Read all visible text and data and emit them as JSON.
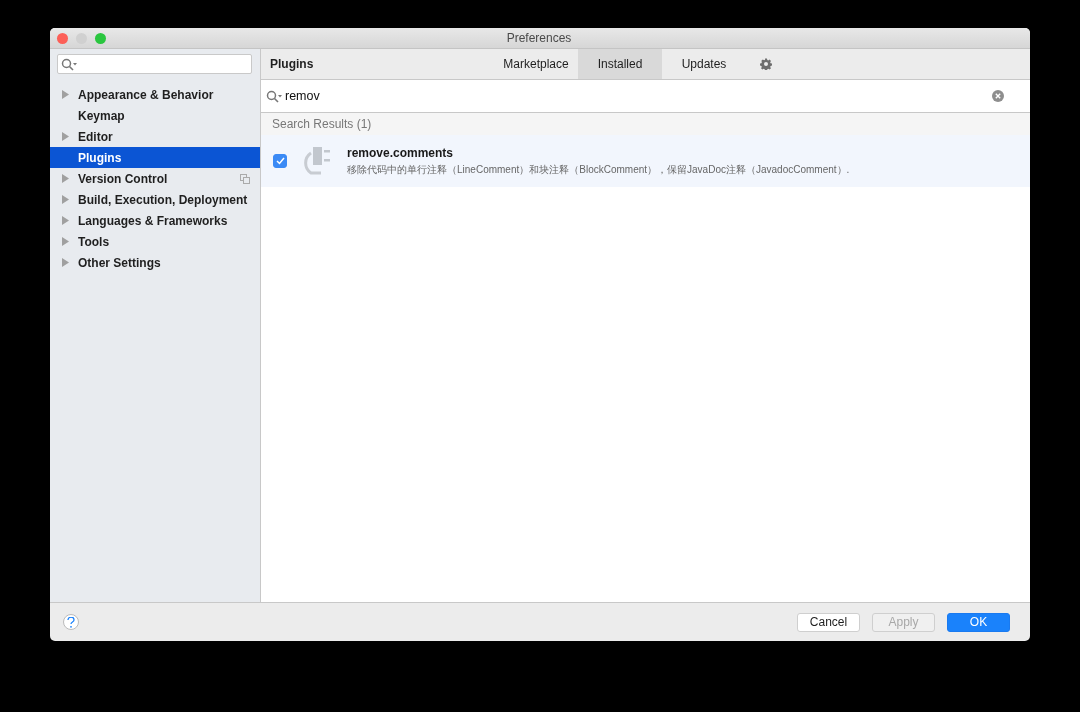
{
  "window": {
    "title": "Preferences"
  },
  "sidebar": {
    "items": [
      {
        "label": "Appearance & Behavior",
        "expandable": true,
        "selected": false,
        "scoped": false
      },
      {
        "label": "Keymap",
        "expandable": false,
        "selected": false,
        "scoped": false
      },
      {
        "label": "Editor",
        "expandable": true,
        "selected": false,
        "scoped": false
      },
      {
        "label": "Plugins",
        "expandable": false,
        "selected": true,
        "scoped": false
      },
      {
        "label": "Version Control",
        "expandable": true,
        "selected": false,
        "scoped": true
      },
      {
        "label": "Build, Execution, Deployment",
        "expandable": true,
        "selected": false,
        "scoped": false
      },
      {
        "label": "Languages & Frameworks",
        "expandable": true,
        "selected": false,
        "scoped": false
      },
      {
        "label": "Tools",
        "expandable": true,
        "selected": false,
        "scoped": false
      },
      {
        "label": "Other Settings",
        "expandable": true,
        "selected": false,
        "scoped": false
      }
    ]
  },
  "header": {
    "title": "Plugins",
    "tabs": [
      {
        "label": "Marketplace",
        "selected": false
      },
      {
        "label": "Installed",
        "selected": true
      },
      {
        "label": "Updates",
        "selected": false
      }
    ]
  },
  "search": {
    "value": "remov"
  },
  "results": {
    "title": "Search Results (1)",
    "plugins": [
      {
        "name": "remove.comments",
        "description": "移除代码中的单行注释（LineComment）和块注释（BlockComment），保留JavaDoc注释（JavadocComment）.",
        "checked": true
      }
    ]
  },
  "footer": {
    "buttons": [
      {
        "label": "Cancel",
        "disabled": false,
        "primary": false
      },
      {
        "label": "Apply",
        "disabled": true,
        "primary": false
      },
      {
        "label": "OK",
        "disabled": false,
        "primary": true
      }
    ]
  }
}
